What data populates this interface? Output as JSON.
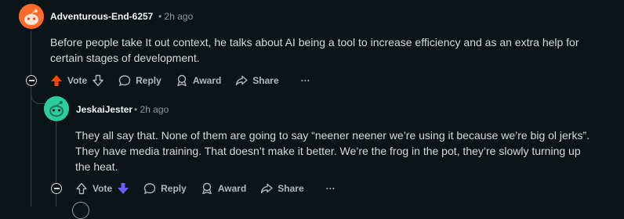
{
  "comments": [
    {
      "author": "Adventurous-End-6257",
      "time": "• 2h ago",
      "text": "Before people take It out context, he talks about AI being a tool to increase efficiency and as an extra help for certain stages of development.",
      "vote_label": "Vote",
      "vote_state": "upvoted",
      "reply_label": "Reply",
      "award_label": "Award",
      "share_label": "Share",
      "more_label": "···",
      "avatar_color": "#ff6a2b",
      "upvote_color": "#ff4500"
    },
    {
      "author": "JeskaiJester",
      "time": "• 2h ago",
      "text_lines": [
        "They all say that. None of them are going to say “neener neener we’re using it because we’re big ol jerks”.",
        "They have media training. That doesn’t make it better. We’re the frog in the pot, they’re slowly turning up",
        "the heat."
      ],
      "vote_label": "Vote",
      "vote_state": "downvoted",
      "reply_label": "Reply",
      "award_label": "Award",
      "share_label": "Share",
      "more_label": "···",
      "avatar_color": "#2ecc9a",
      "downvote_color": "#6a5cff"
    }
  ]
}
